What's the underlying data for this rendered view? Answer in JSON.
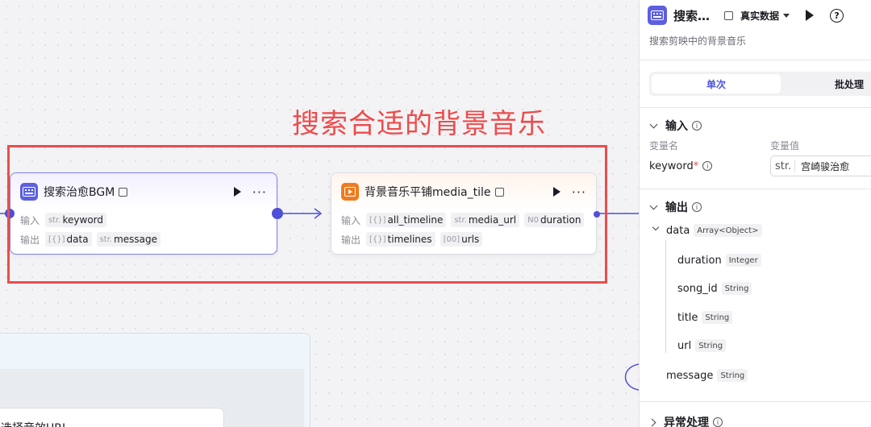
{
  "annotation": {
    "title": "搜索合适的背景音乐"
  },
  "node1": {
    "title": "搜索治愈BGM",
    "input_label": "输入",
    "output_label": "输出",
    "inputs": [
      {
        "type": "str.",
        "name": "keyword"
      }
    ],
    "outputs": [
      {
        "type": "[{}]",
        "name": "data"
      },
      {
        "type": "str.",
        "name": "message"
      }
    ]
  },
  "node2": {
    "title": "背景音乐平铺media_tile",
    "input_label": "输入",
    "output_label": "输出",
    "inputs": [
      {
        "type": "[{}]",
        "name": "all_timeline"
      },
      {
        "type": "str.",
        "name": "media_url"
      },
      {
        "type": "N0",
        "name": "duration"
      }
    ],
    "outputs": [
      {
        "type": "[{}]",
        "name": "timelines"
      },
      {
        "type": "[00]",
        "name": "urls"
      }
    ]
  },
  "partial_node": {
    "title": "选择音效URL"
  },
  "panel": {
    "title": "搜索…",
    "mode": "真实数据",
    "help": "?",
    "description": "搜索剪映中的背景音乐",
    "tabs": [
      "单次",
      "批处理"
    ],
    "input_section": "输入",
    "col_var_name": "变量名",
    "col_var_value": "变量值",
    "param": {
      "name": "keyword",
      "required_mark": "*",
      "type": "str.",
      "value": "宫崎骏治愈"
    },
    "output_section": "输出",
    "outputs": [
      {
        "name": "data",
        "type": "Array<Object>"
      },
      {
        "name": "duration",
        "type": "Integer"
      },
      {
        "name": "song_id",
        "type": "String"
      },
      {
        "name": "title",
        "type": "String"
      },
      {
        "name": "url",
        "type": "String"
      },
      {
        "name": "message",
        "type": "String"
      }
    ],
    "exception_section": "异常处理"
  },
  "colors": {
    "accent": "#4d53e8",
    "annotation_red": "#ee4b4b",
    "node_icon_purple": "#5b5fe0",
    "node_icon_orange": "#f07b1c"
  }
}
